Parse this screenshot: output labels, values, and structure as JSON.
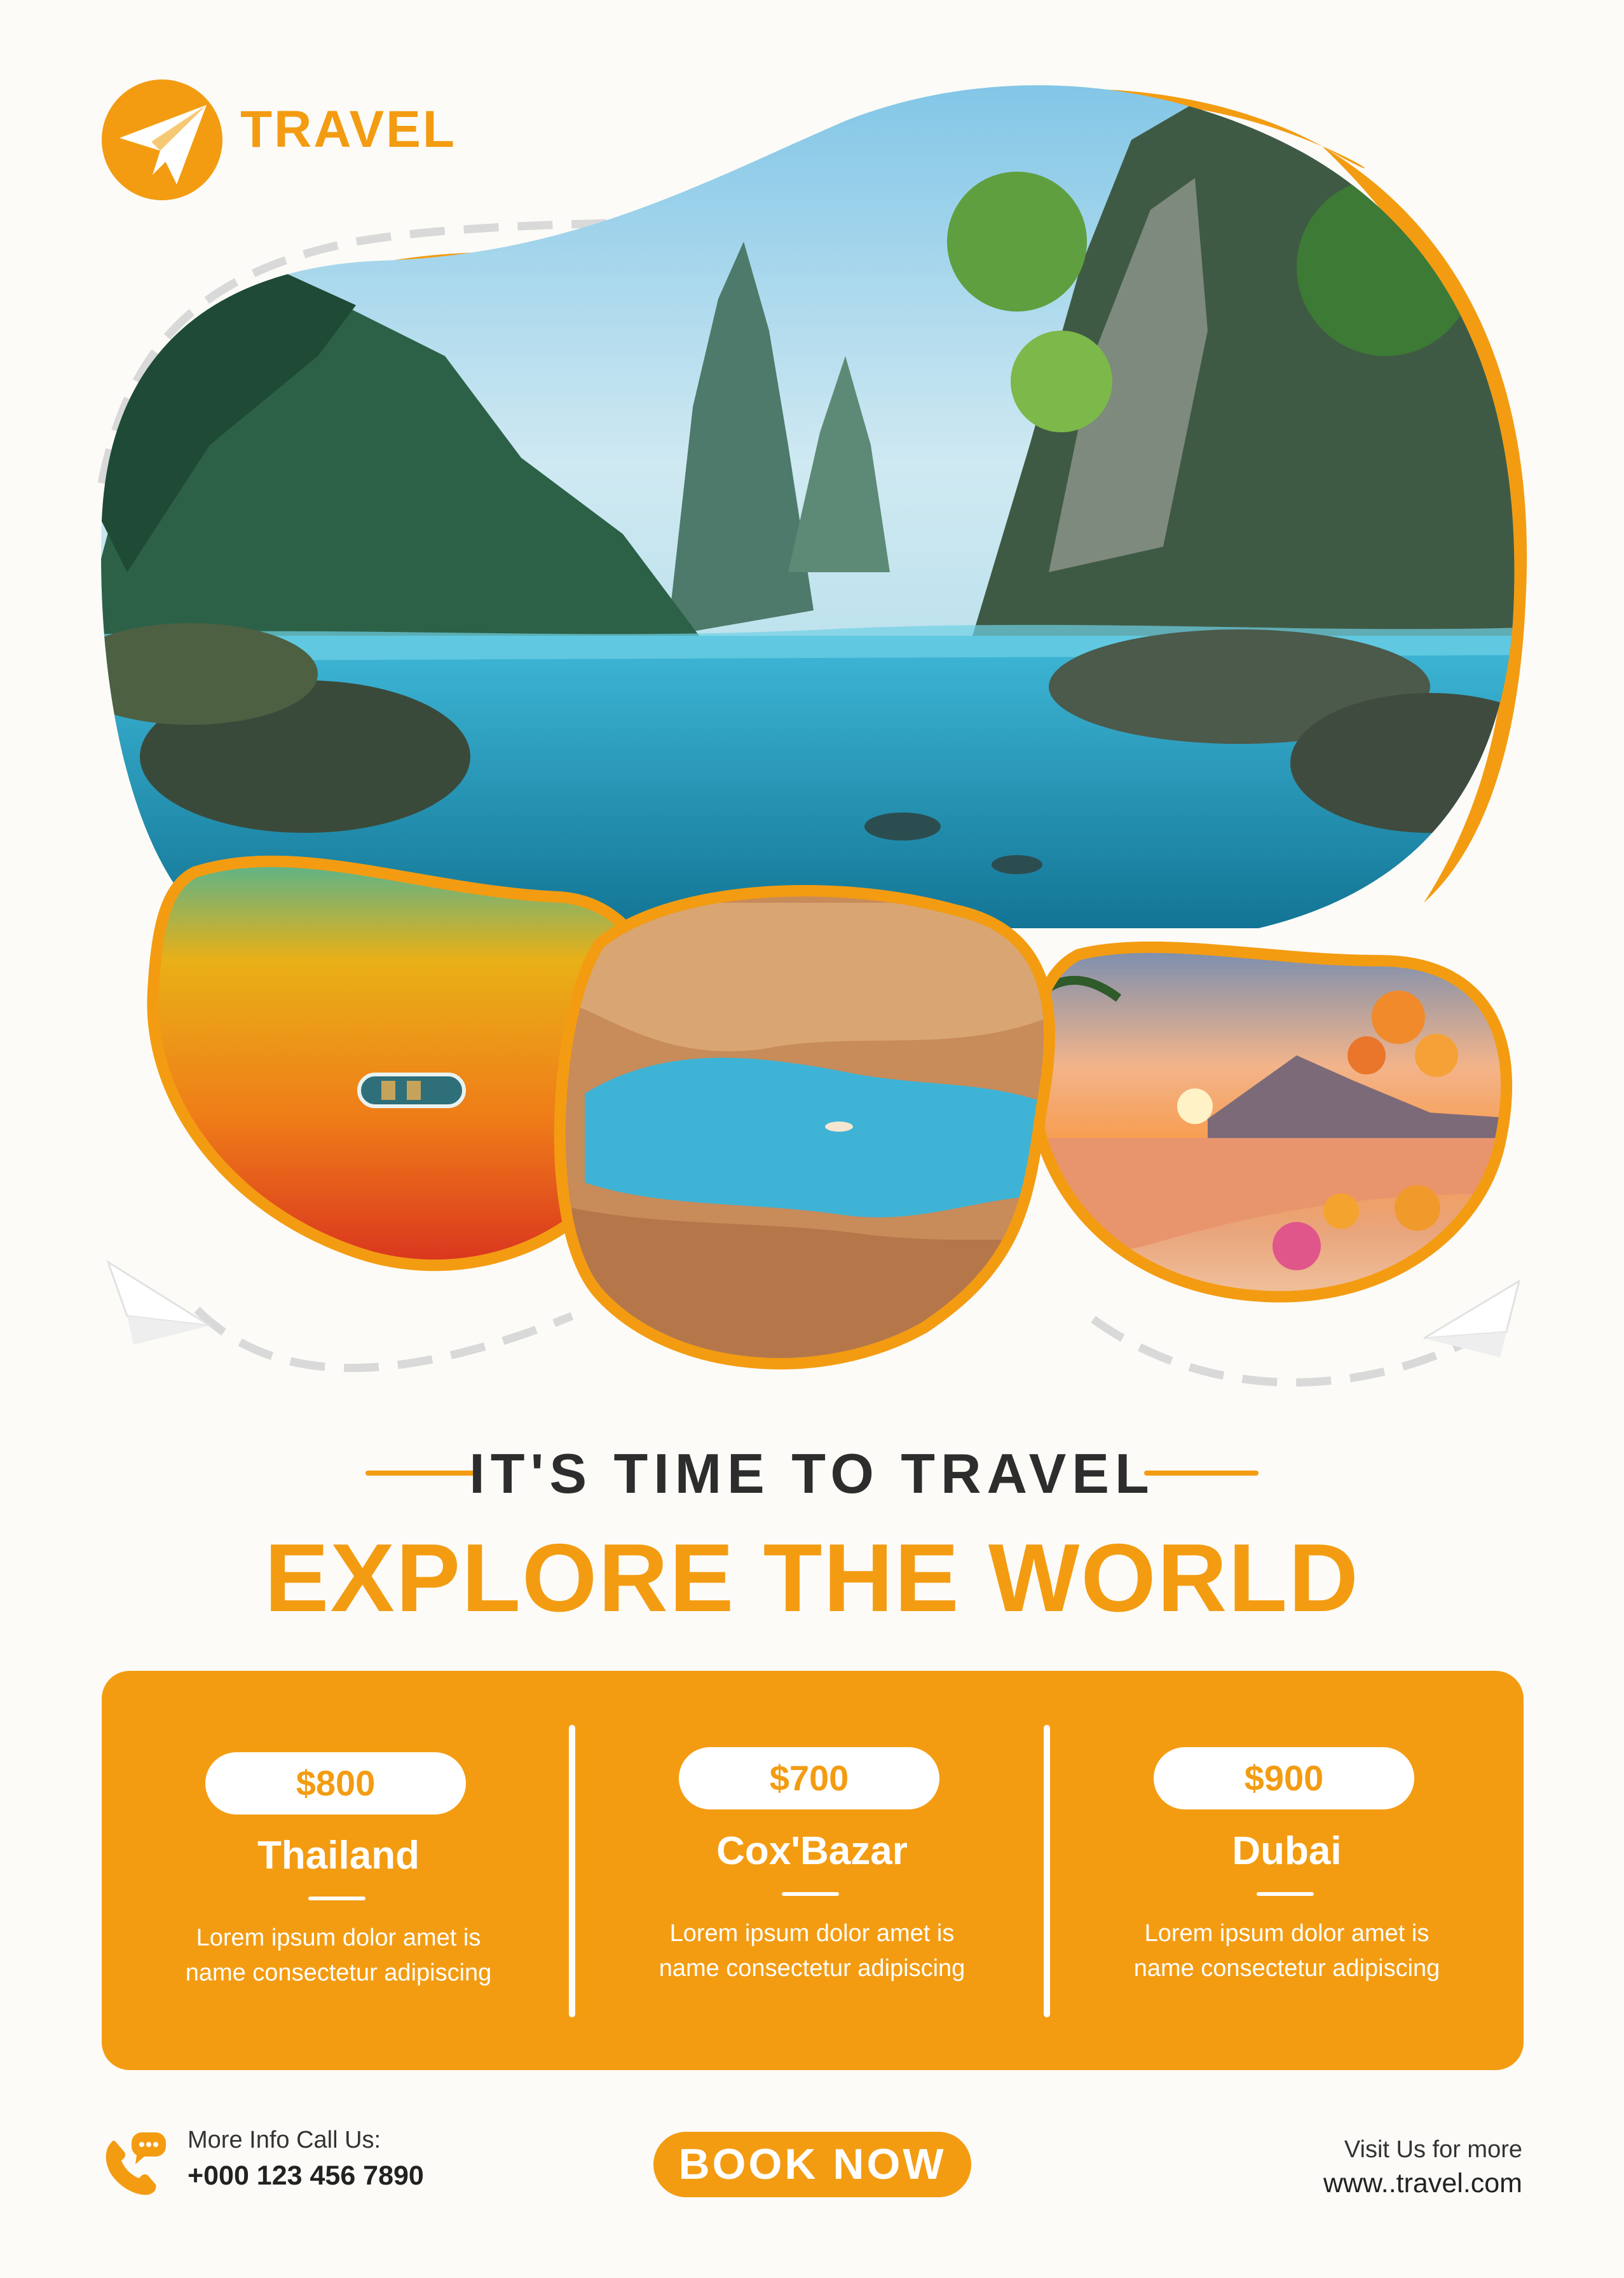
{
  "brand": {
    "name": "TRAVEL",
    "icon": "paper-plane-icon"
  },
  "hero": {
    "main_image": "tropical lagoon with cliffs",
    "thumbnails": [
      "aerial boat on colorful water",
      "aerial canyon with blue lake",
      "beach sunset with hibiscus flowers"
    ]
  },
  "heading": {
    "tagline": "IT'S TIME TO TRAVEL",
    "headline": "EXPLORE THE WORLD"
  },
  "packages": [
    {
      "price": "$800",
      "name": "Thailand",
      "desc_line1": "Lorem ipsum dolor amet is",
      "desc_line2": "name consectetur adipiscing"
    },
    {
      "price": "$700",
      "name": "Cox'Bazar",
      "desc_line1": "Lorem ipsum dolor amet is",
      "desc_line2": "name consectetur adipiscing"
    },
    {
      "price": "$900",
      "name": "Dubai",
      "desc_line1": "Lorem ipsum dolor amet is",
      "desc_line2": "name consectetur adipiscing"
    }
  ],
  "footer": {
    "contact_label": "More Info Call Us:",
    "phone": "+000 123 456 7890",
    "book_label": "BOOK NOW",
    "visit_label": "Visit Us for more",
    "website": "www..travel.com"
  },
  "colors": {
    "accent": "#f39c12",
    "background": "#fcfbf7",
    "text_dark": "#2d2d2d"
  }
}
